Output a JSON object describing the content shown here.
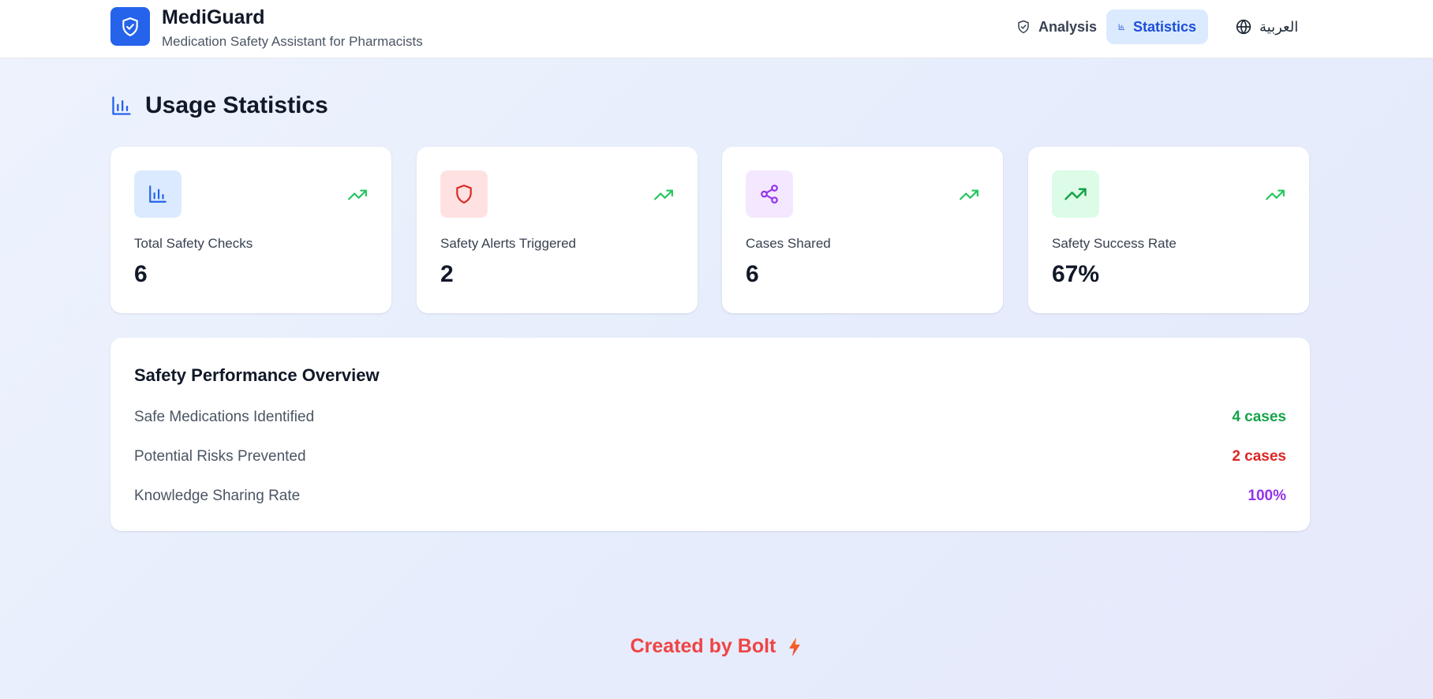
{
  "header": {
    "app_name": "MediGuard",
    "subtitle": "Medication Safety Assistant for Pharmacists",
    "nav": [
      {
        "label": "Analysis",
        "icon": "shield-check-icon",
        "active": false
      },
      {
        "label": "Statistics",
        "icon": "bar-chart-icon",
        "active": true
      },
      {
        "label": "العربية",
        "icon": "globe-icon",
        "active": false
      }
    ]
  },
  "page": {
    "title": "Usage Statistics",
    "title_icon": "bar-chart-icon"
  },
  "cards": [
    {
      "label": "Total Safety Checks",
      "value": "6",
      "icon": "bar-chart-icon",
      "icon_color": "#2563eb",
      "icon_bg": "#dbeafe",
      "trend_icon": "trending-up-icon"
    },
    {
      "label": "Safety Alerts Triggered",
      "value": "2",
      "icon": "shield-icon",
      "icon_color": "#dc2626",
      "icon_bg": "#fee2e2",
      "trend_icon": "trending-up-icon"
    },
    {
      "label": "Cases Shared",
      "value": "6",
      "icon": "share-icon",
      "icon_color": "#9333ea",
      "icon_bg": "#f3e8ff",
      "trend_icon": "trending-up-icon"
    },
    {
      "label": "Safety Success Rate",
      "value": "67%",
      "icon": "trending-up-icon",
      "icon_color": "#16a34a",
      "icon_bg": "#dcfce7",
      "trend_icon": "trending-up-icon"
    }
  ],
  "overview": {
    "title": "Safety Performance Overview",
    "rows": [
      {
        "label": "Safe Medications Identified",
        "value": "4 cases",
        "color": "#16a34a"
      },
      {
        "label": "Potential Risks Prevented",
        "value": "2 cases",
        "color": "#dc2626"
      },
      {
        "label": "Knowledge Sharing Rate",
        "value": "100%",
        "color": "#9333ea"
      }
    ]
  },
  "footer": {
    "text": "Created by Bolt",
    "icon": "lightning-bolt-icon",
    "color": "#ef4444"
  },
  "colors": {
    "primary": "#2563eb",
    "trend": "#22c55e"
  }
}
